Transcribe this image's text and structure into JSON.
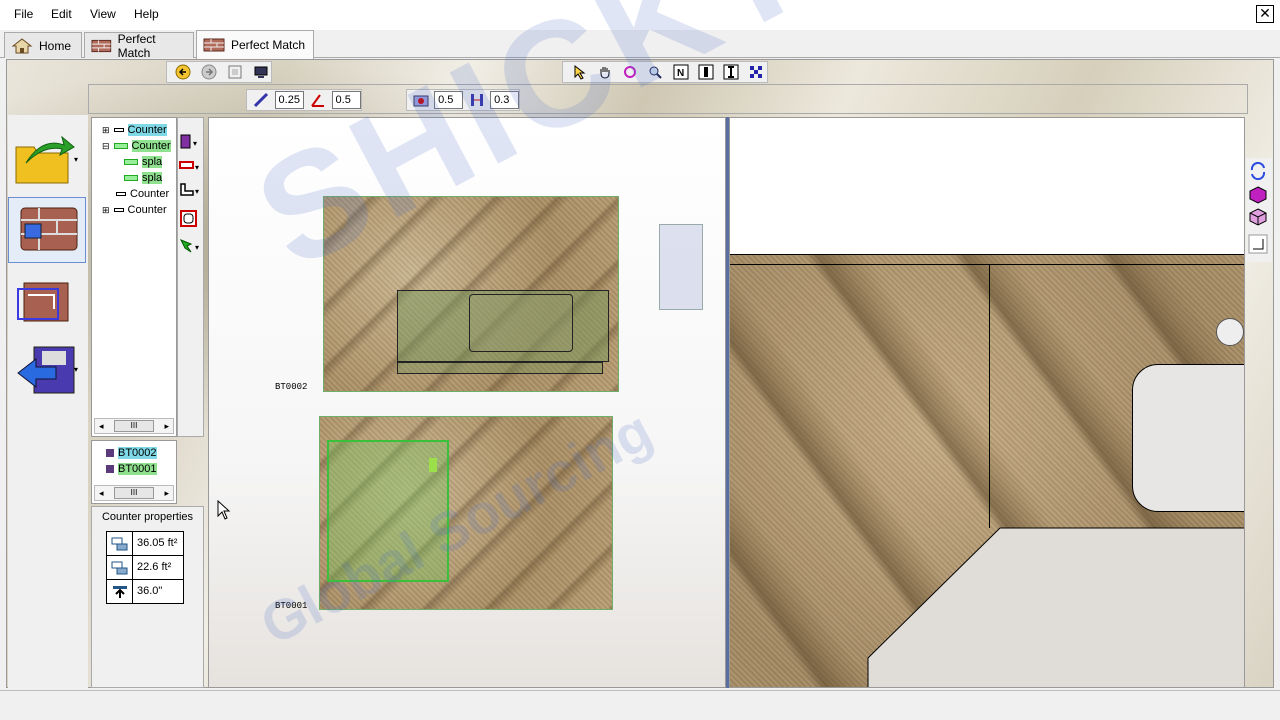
{
  "menu": {
    "file": "File",
    "edit": "Edit",
    "view": "View",
    "help": "Help"
  },
  "tabs": [
    {
      "label": "Home"
    },
    {
      "label": "Perfect Match"
    },
    {
      "label": "Perfect Match"
    }
  ],
  "toolbar2": {
    "field1": "0.25",
    "field2": "0.5",
    "field3": "0.5",
    "field4": "0.3"
  },
  "tree": {
    "items": [
      {
        "label": "Counter"
      },
      {
        "label": "Counter"
      },
      {
        "label": "spla"
      },
      {
        "label": "spla"
      },
      {
        "label": "Counter"
      },
      {
        "label": "Counter"
      }
    ],
    "scroll_thumb": "III"
  },
  "slabs_list": {
    "items": [
      {
        "label": "BT0002"
      },
      {
        "label": "BT0001"
      }
    ],
    "scroll_thumb": "III"
  },
  "counter_properties": {
    "title": "Counter properties",
    "area1": "36.05 ft²",
    "area2": "22.6 ft²",
    "height": "36.0\""
  },
  "canvas": {
    "slab_top_label": "BT0002",
    "slab_bottom_label": "BT0001"
  },
  "watermark": {
    "main": "SHICKTEC",
    "sub": "Global Sourcing"
  }
}
